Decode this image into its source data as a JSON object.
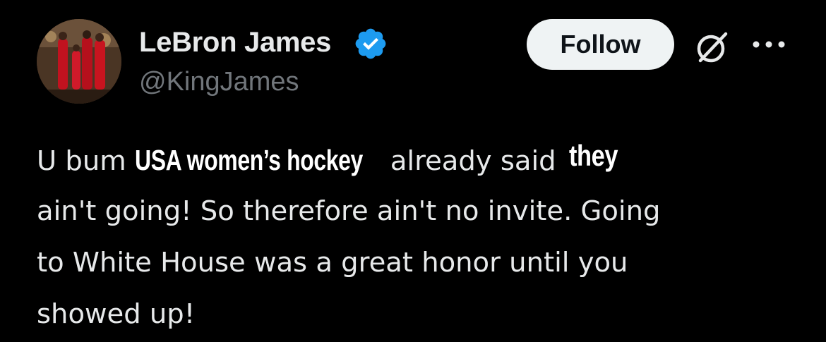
{
  "author": {
    "display_name": "LeBron James",
    "handle": "@KingJames",
    "verified": true,
    "avatar_icon": "avatar-photo"
  },
  "actions": {
    "follow_label": "Follow",
    "grok_icon": "grok-icon",
    "more_icon": "more-icon"
  },
  "tweet": {
    "line1_start": "U bum",
    "sticker_1": "USA women’s hockey",
    "line1_mid": "already said",
    "sticker_2": "they",
    "line2": "ain't going! So therefore ain't no invite. Going",
    "line3": "to White House was a great honor until you",
    "line4": "showed up!"
  },
  "colors": {
    "background": "#000000",
    "text_primary": "#e7e9ea",
    "text_secondary": "#71767b",
    "verified_badge": "#1d9bf0",
    "follow_bg": "#eff3f4"
  }
}
